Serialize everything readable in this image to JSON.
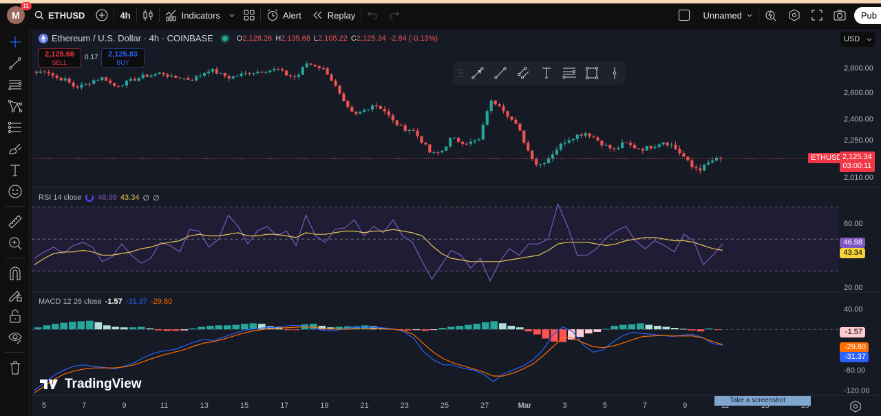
{
  "topbar": {
    "avatar_letter": "M",
    "notification_count": "11",
    "symbol": "ETHUSD",
    "interval": "4h",
    "indicators_label": "Indicators",
    "alert_label": "Alert",
    "replay_label": "Replay",
    "layout_name": "Unnamed",
    "publish_label": "Pub"
  },
  "legend": {
    "title": "Ethereum / U.S. Dollar · 4h · COINBASE",
    "o_label": "O",
    "o": "2,128.26",
    "h_label": "H",
    "h": "2,135.68",
    "l_label": "L",
    "l": "2,105.22",
    "c_label": "C",
    "c": "2,125.34",
    "change": "-2.84 (-0.13%)"
  },
  "trade": {
    "sell_price": "2,125.66",
    "sell_label": "SELL",
    "spread": "0.17",
    "buy_price": "2,125.83",
    "buy_label": "BUY"
  },
  "currency": "USD",
  "price_label": {
    "symbol": "ETHUSD",
    "price": "2,125.34",
    "countdown": "03:00:11"
  },
  "rsi_legend": {
    "name": "RSI 14 close",
    "rsi": "46.98",
    "ma": "43.34",
    "extra1": "∅",
    "extra2": "∅"
  },
  "macd_legend": {
    "name": "MACD 12 26 close",
    "hist": "-1.57",
    "macd": "-31.37",
    "signal": "-29.80"
  },
  "watermark": "TradingView",
  "tooltip": "Take a screenshot",
  "colors": {
    "up": "#26a69a",
    "down": "#ef5350",
    "rsi": "#7e57c2",
    "rsi_ma": "#e8c65a",
    "macd": "#2962ff",
    "signal": "#ff6d00",
    "price_tag": "#f23645"
  },
  "chart_data": [
    {
      "type": "candlestick",
      "title": "Ethereum / U.S. Dollar · 4h · COINBASE",
      "x_ticks": [
        "5",
        "7",
        "9",
        "11",
        "13",
        "15",
        "17",
        "19",
        "21",
        "23",
        "25",
        "27",
        "Mar",
        "3",
        "5",
        "7",
        "9",
        "11",
        "13",
        "15"
      ],
      "y_ticks": [
        "2,800.00",
        "2,600.00",
        "2,400.00",
        "2,250.00",
        "2,010.00"
      ],
      "y_tick_values": [
        2800,
        2600,
        2400,
        2250,
        2010
      ],
      "ylim": [
        1980,
        2900
      ],
      "log_scale": true,
      "last_close": 2125.34,
      "close_path": [
        2760,
        2780,
        2720,
        2700,
        2640,
        2660,
        2700,
        2720,
        2650,
        2670,
        2700,
        2730,
        2740,
        2760,
        2720,
        2720,
        2700,
        2740,
        2790,
        2750,
        2720,
        2740,
        2760,
        2770,
        2780,
        2790,
        2740,
        2720,
        2840,
        2820,
        2780,
        2650,
        2500,
        2420,
        2460,
        2510,
        2470,
        2380,
        2330,
        2320,
        2240,
        2150,
        2170,
        2260,
        2240,
        2230,
        2250,
        2530,
        2510,
        2420,
        2330,
        2180,
        2080,
        2120,
        2190,
        2250,
        2280,
        2300,
        2260,
        2210,
        2180,
        2230,
        2200,
        2190,
        2210,
        2240,
        2210,
        2150,
        2070,
        2060,
        2110,
        2125
      ]
    },
    {
      "type": "line",
      "title": "RSI 14 close",
      "ylim": [
        17,
        78
      ],
      "y_ticks": [
        "60.00",
        "20.00"
      ],
      "bands": [
        70,
        50,
        30
      ],
      "series": [
        {
          "name": "RSI",
          "values": [
            38,
            42,
            45,
            41,
            46,
            48,
            45,
            36,
            39,
            47,
            40,
            35,
            38,
            48,
            46,
            42,
            56,
            55,
            45,
            50,
            65,
            58,
            47,
            55,
            58,
            52,
            55,
            46,
            65,
            52,
            48,
            56,
            57,
            62,
            52,
            58,
            54,
            62,
            52,
            48,
            36,
            25,
            34,
            43,
            40,
            32,
            38,
            24,
            36,
            44,
            40,
            47,
            47,
            50,
            72,
            58,
            40,
            40,
            44,
            51,
            55,
            58,
            49,
            44,
            49,
            46,
            42,
            53,
            49,
            34,
            40,
            47
          ]
        },
        {
          "name": "RSI-based MA",
          "values": [
            34,
            38,
            41,
            42,
            42,
            43,
            42,
            40,
            40,
            41,
            42,
            44,
            45,
            47,
            48,
            49,
            52,
            53,
            52,
            52,
            53,
            54,
            52,
            52,
            53,
            53,
            52,
            51,
            54,
            53,
            53,
            54,
            55,
            55,
            54,
            55,
            55,
            56,
            55,
            54,
            52,
            46,
            41,
            38,
            37,
            36,
            36,
            36,
            36,
            37,
            38,
            39,
            40,
            43,
            47,
            48,
            48,
            48,
            47,
            46,
            47,
            49,
            50,
            51,
            51,
            50,
            49,
            49,
            48,
            46,
            44,
            43
          ]
        }
      ]
    },
    {
      "type": "bar+line",
      "title": "MACD 12 26 close",
      "ylim": [
        -130,
        60
      ],
      "y_ticks": [
        "40.00",
        "-80.00",
        "-120.00"
      ],
      "series": [
        {
          "name": "Histogram",
          "values": [
            4,
            8,
            11,
            13,
            15,
            16,
            17,
            14,
            8,
            5,
            4,
            4,
            5,
            2,
            -2,
            -3,
            -3,
            -2,
            2,
            5,
            7,
            8,
            8,
            9,
            11,
            12,
            11,
            6,
            4,
            -1,
            -1,
            10,
            11,
            7,
            4,
            5,
            6,
            6,
            8,
            6,
            3,
            1,
            -1,
            -2,
            -1,
            -3,
            -1,
            3,
            5,
            7,
            9,
            11,
            14,
            16,
            12,
            7,
            4,
            -4,
            -10,
            -18,
            -24,
            -25,
            -20,
            -15,
            -8,
            -5,
            1,
            7,
            9,
            10,
            12,
            9,
            7,
            5,
            3,
            1,
            -2,
            -4,
            2,
            -1
          ]
        },
        {
          "name": "MACD",
          "values": [
            -120,
            -105,
            -90,
            -80,
            -72,
            -70,
            -73,
            -75,
            -78,
            -73,
            -66,
            -55,
            -47,
            -42,
            -40,
            -33,
            -25,
            -20,
            -22,
            -15,
            -8,
            -2,
            1,
            3,
            4,
            6,
            8,
            7,
            2,
            -2,
            -3,
            1,
            4,
            5,
            4,
            3,
            1,
            -4,
            -17,
            -44,
            -60,
            -70,
            -70,
            -77,
            -80,
            -88,
            -103,
            -88,
            -80,
            -72,
            -60,
            -40,
            -10,
            5,
            -5,
            -30,
            -45,
            -40,
            -25,
            -12,
            -6,
            -8,
            -10,
            -12,
            -14,
            -11,
            -10,
            -16,
            -28,
            -31
          ]
        },
        {
          "name": "Signal",
          "values": [
            -125,
            -112,
            -98,
            -88,
            -82,
            -78,
            -76,
            -76,
            -76,
            -74,
            -70,
            -63,
            -56,
            -50,
            -45,
            -40,
            -33,
            -27,
            -24,
            -19,
            -13,
            -7,
            -3,
            0,
            2,
            3,
            4,
            5,
            4,
            2,
            1,
            0,
            1,
            2,
            2,
            1,
            0,
            -2,
            -10,
            -28,
            -45,
            -58,
            -66,
            -72,
            -78,
            -84,
            -92,
            -92,
            -86,
            -78,
            -68,
            -52,
            -34,
            -16,
            -17,
            -26,
            -34,
            -36,
            -33,
            -27,
            -20,
            -14,
            -13,
            -12,
            -13,
            -13,
            -13,
            -17,
            -24,
            -30
          ]
        }
      ]
    }
  ]
}
